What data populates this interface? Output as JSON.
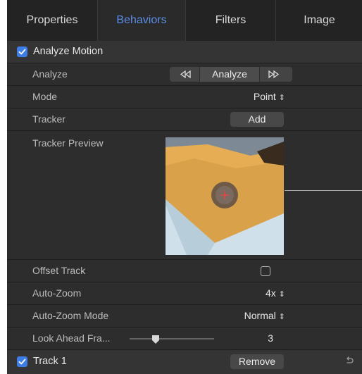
{
  "tabs": [
    {
      "label": "Properties"
    },
    {
      "label": "Behaviors"
    },
    {
      "label": "Filters"
    },
    {
      "label": "Image"
    }
  ],
  "analyze_motion": {
    "title": "Analyze Motion",
    "analyze_label": "Analyze",
    "analyze_button": "Analyze",
    "mode_label": "Mode",
    "mode_value": "Point",
    "tracker_label": "Tracker",
    "tracker_button": "Add",
    "preview_label": "Tracker Preview",
    "offset_label": "Offset Track",
    "autozoom_label": "Auto-Zoom",
    "autozoom_value": "4x",
    "autozoom_mode_label": "Auto-Zoom Mode",
    "autozoom_mode_value": "Normal",
    "lookahead_label": "Look Ahead Fra...",
    "lookahead_value": "3"
  },
  "track": {
    "title": "Track 1",
    "remove_button": "Remove"
  },
  "colors": {
    "accent": "#3f7de6",
    "active_tab": "#5c8de6"
  }
}
